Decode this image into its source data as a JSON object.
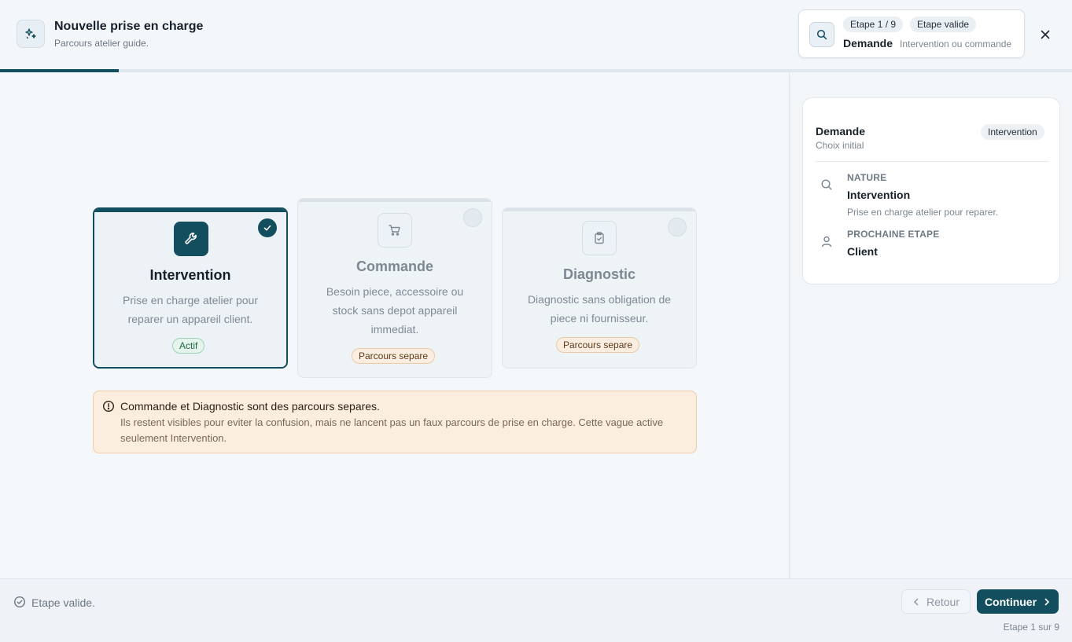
{
  "header": {
    "title": "Nouvelle prise en charge",
    "subtitle": "Parcours atelier guide.",
    "step_chip": "Etape 1 / 9",
    "valid_chip": "Etape valide",
    "step_name": "Demande",
    "step_hint": "Intervention ou commande",
    "progress": 0.111
  },
  "options": [
    {
      "title": "Intervention",
      "description": "Prise en charge atelier pour reparer un appareil client.",
      "badge": "Actif",
      "selected": true,
      "icon": "wrench-icon"
    },
    {
      "title": "Commande",
      "description": "Besoin piece, accessoire ou stock sans depot appareil immediat.",
      "badge": "Parcours separe",
      "selected": false,
      "icon": "cart-icon"
    },
    {
      "title": "Diagnostic",
      "description": "Diagnostic sans obligation de piece ni fournisseur.",
      "badge": "Parcours separe",
      "selected": false,
      "icon": "clipboard-check-icon"
    }
  ],
  "notice": {
    "title": "Commande et Diagnostic sont des parcours separes.",
    "text": "Ils restent visibles pour eviter la confusion, mais ne lancent pas un faux parcours de prise en charge. Cette vague active seulement Intervention."
  },
  "summary": {
    "title": "Demande",
    "subtitle": "Choix initial",
    "chip": "Intervention",
    "rows": [
      {
        "label": "NATURE",
        "value": "Intervention",
        "note": "Prise en charge atelier pour reparer.",
        "icon": "search-icon"
      },
      {
        "label": "PROCHAINE ETAPE",
        "value": "Client",
        "note": "",
        "icon": "user-icon"
      }
    ]
  },
  "footer": {
    "status": "Etape valide.",
    "back_label": "Retour",
    "next_label": "Continuer",
    "step_text": "Etape 1 sur 9"
  },
  "colors": {
    "accent": "#134e5e",
    "active_badge": "#e5f4ec",
    "separate_badge": "#fbeee0",
    "notice_bg": "#fbeede"
  }
}
